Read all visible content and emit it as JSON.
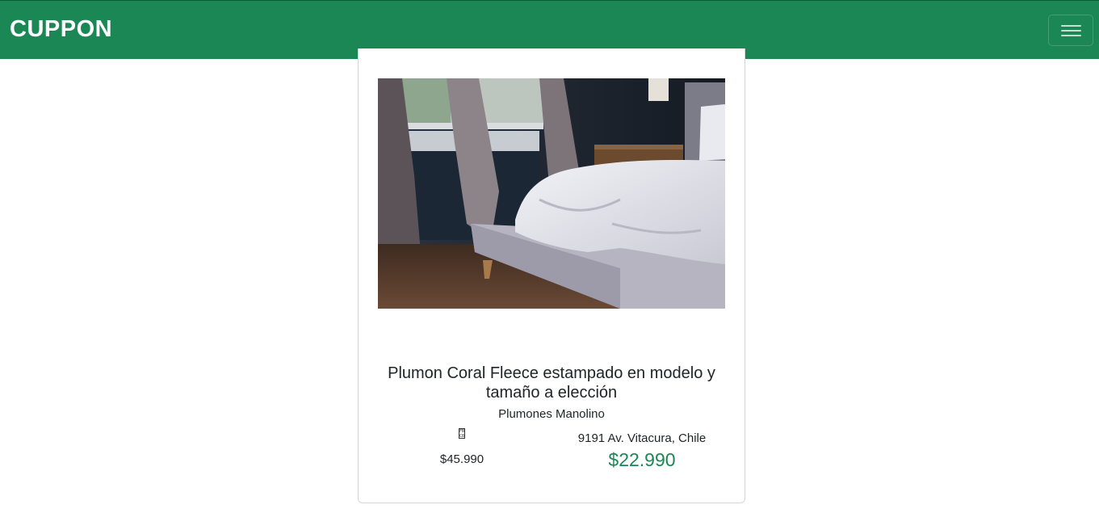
{
  "navbar": {
    "brand": "CUPPON",
    "menu_icon": "hamburger-icon",
    "bg_color": "#1b8754"
  },
  "deal": {
    "image_alt": "Dormitorio con cama y plumón blanco",
    "title": "Plumon Coral Fleece estampado en modelo y tamaño a elección",
    "merchant": "Plumones Manolino",
    "flag_icon": "flag-glyph-icon",
    "flag_glyph_text": "FB\nC8",
    "original_price": "$45.990",
    "location": "9191 Av. Vitacura, Chile",
    "discount_price": "$22.990",
    "price_color": "#1b8754"
  }
}
